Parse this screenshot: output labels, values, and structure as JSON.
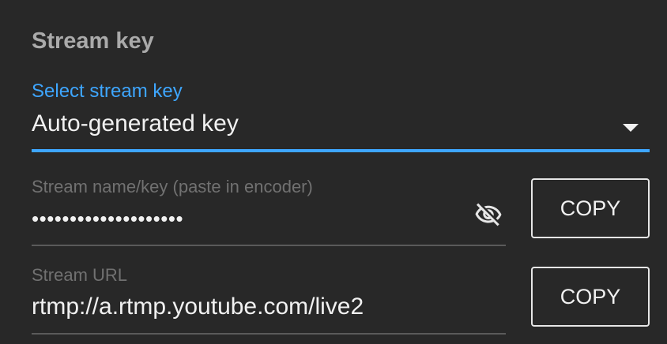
{
  "section": {
    "title": "Stream key"
  },
  "select_stream_key": {
    "label": "Select stream key",
    "value": "Auto-generated key"
  },
  "stream_key_field": {
    "label": "Stream name/key (paste in encoder)",
    "value": "••••••••••••••••••••",
    "visibility_icon": "visibility-off-icon",
    "copy_label": "COPY"
  },
  "stream_url_field": {
    "label": "Stream URL",
    "value": "rtmp://a.rtmp.youtube.com/live2",
    "copy_label": "COPY"
  },
  "colors": {
    "background": "#282828",
    "accent": "#3ea6ff",
    "text_primary": "#f1f1f1",
    "text_secondary": "#717171"
  }
}
